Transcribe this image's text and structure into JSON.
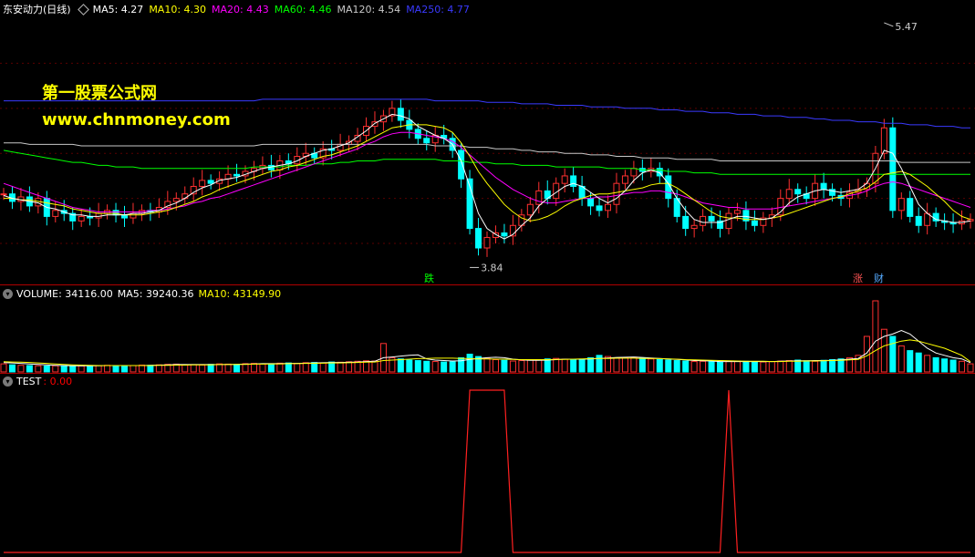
{
  "header": {
    "stock_name": "东安动力(日线)",
    "ma": [
      {
        "label": "MA5: 4.27",
        "color": "#ffffff"
      },
      {
        "label": "MA10: 4.30",
        "color": "#ffff00"
      },
      {
        "label": "MA20: 4.43",
        "color": "#ff00ff"
      },
      {
        "label": "MA60: 4.46",
        "color": "#00ff00"
      },
      {
        "label": "MA120: 4.54",
        "color": "#c8c8c8"
      },
      {
        "label": "MA250: 4.77",
        "color": "#3a3aff"
      }
    ]
  },
  "volume_header": {
    "title": "VOLUME: 34116.00",
    "ma5": "MA5: 39240.36",
    "ma10": "MA10: 43149.90",
    "colors": {
      "title": "#ffffff",
      "ma5": "#ffffff",
      "ma10": "#ffff00"
    }
  },
  "test_header": {
    "title": "TEST",
    "value": ": 0.00",
    "colors": {
      "title": "#ffffff",
      "value": "#ff0000"
    }
  },
  "watermark": {
    "line1": "第一股票公式网",
    "line2": "www.chnmoney.com"
  },
  "annotations": {
    "high": "5.47",
    "low": "3.84",
    "tag_down": "跌",
    "tag_up": "涨",
    "tag_cai": "财"
  },
  "chart_data": [
    {
      "type": "candlestick",
      "title": "东安动力(日线)",
      "ylim": [
        3.8,
        5.5
      ],
      "high_mark": 5.47,
      "low_mark": 3.84,
      "close": [
        4.33,
        4.28,
        4.31,
        4.25,
        4.3,
        4.18,
        4.22,
        4.2,
        4.15,
        4.18,
        4.17,
        4.2,
        4.22,
        4.19,
        4.17,
        4.2,
        4.22,
        4.21,
        4.24,
        4.28,
        4.3,
        4.33,
        4.38,
        4.42,
        4.4,
        4.43,
        4.46,
        4.45,
        4.48,
        4.5,
        4.52,
        4.49,
        4.55,
        4.53,
        4.58,
        4.6,
        4.57,
        4.63,
        4.62,
        4.66,
        4.68,
        4.72,
        4.78,
        4.81,
        4.85,
        4.9,
        4.82,
        4.76,
        4.7,
        4.67,
        4.72,
        4.7,
        4.62,
        4.43,
        4.1,
        3.97,
        4.04,
        4.07,
        4.05,
        4.12,
        4.19,
        4.26,
        4.35,
        4.3,
        4.4,
        4.45,
        4.38,
        4.3,
        4.25,
        4.22,
        4.26,
        4.4,
        4.45,
        4.5,
        4.48,
        4.5,
        4.45,
        4.3,
        4.18,
        4.1,
        4.12,
        4.18,
        4.15,
        4.1,
        4.2,
        4.22,
        4.15,
        4.12,
        4.17,
        4.19,
        4.3,
        4.36,
        4.33,
        4.3,
        4.4,
        4.36,
        4.32,
        4.3,
        4.34,
        4.36,
        4.4,
        4.6,
        4.77,
        4.22,
        4.3,
        4.18,
        4.12,
        4.2,
        4.15,
        4.14,
        4.13,
        4.15,
        4.16
      ],
      "ma5": [
        4.32,
        4.3,
        4.29,
        4.28,
        4.27,
        4.24,
        4.23,
        4.21,
        4.19,
        4.19,
        4.18,
        4.18,
        4.19,
        4.19,
        4.19,
        4.2,
        4.2,
        4.21,
        4.22,
        4.25,
        4.27,
        4.3,
        4.34,
        4.37,
        4.39,
        4.42,
        4.43,
        4.44,
        4.46,
        4.48,
        4.5,
        4.51,
        4.52,
        4.53,
        4.55,
        4.58,
        4.6,
        4.62,
        4.63,
        4.65,
        4.67,
        4.71,
        4.75,
        4.8,
        4.83,
        4.86,
        4.85,
        4.83,
        4.78,
        4.75,
        4.72,
        4.7,
        4.66,
        4.55,
        4.38,
        4.2,
        4.1,
        4.06,
        4.03,
        4.06,
        4.12,
        4.17,
        4.25,
        4.3,
        4.34,
        4.38,
        4.4,
        4.38,
        4.34,
        4.3,
        4.27,
        4.3,
        4.35,
        4.42,
        4.47,
        4.49,
        4.47,
        4.4,
        4.3,
        4.22,
        4.16,
        4.14,
        4.14,
        4.14,
        4.16,
        4.18,
        4.18,
        4.17,
        4.16,
        4.17,
        4.21,
        4.27,
        4.31,
        4.33,
        4.35,
        4.36,
        4.35,
        4.34,
        4.35,
        4.36,
        4.4,
        4.5,
        4.62,
        4.6,
        4.5,
        4.38,
        4.26,
        4.2,
        4.16,
        4.15,
        4.14,
        4.14,
        4.15
      ],
      "ma10": [
        4.3,
        4.3,
        4.29,
        4.29,
        4.28,
        4.27,
        4.26,
        4.25,
        4.23,
        4.22,
        4.21,
        4.2,
        4.2,
        4.2,
        4.19,
        4.19,
        4.19,
        4.2,
        4.21,
        4.22,
        4.24,
        4.26,
        4.28,
        4.31,
        4.33,
        4.36,
        4.38,
        4.4,
        4.42,
        4.44,
        4.46,
        4.48,
        4.49,
        4.51,
        4.52,
        4.54,
        4.56,
        4.58,
        4.59,
        4.61,
        4.63,
        4.65,
        4.68,
        4.71,
        4.74,
        4.77,
        4.78,
        4.79,
        4.79,
        4.79,
        4.78,
        4.77,
        4.74,
        4.67,
        4.58,
        4.48,
        4.4,
        4.33,
        4.26,
        4.21,
        4.17,
        4.15,
        4.16,
        4.18,
        4.21,
        4.25,
        4.28,
        4.3,
        4.32,
        4.33,
        4.33,
        4.34,
        4.35,
        4.36,
        4.37,
        4.39,
        4.4,
        4.4,
        4.37,
        4.33,
        4.29,
        4.25,
        4.21,
        4.18,
        4.17,
        4.17,
        4.16,
        4.16,
        4.16,
        4.17,
        4.18,
        4.2,
        4.22,
        4.24,
        4.26,
        4.28,
        4.3,
        4.31,
        4.33,
        4.35,
        4.37,
        4.41,
        4.46,
        4.47,
        4.48,
        4.46,
        4.42,
        4.38,
        4.33,
        4.28,
        4.22,
        4.18,
        4.16
      ],
      "ma20": [
        4.4,
        4.38,
        4.36,
        4.34,
        4.32,
        4.3,
        4.28,
        4.26,
        4.24,
        4.23,
        4.22,
        4.21,
        4.21,
        4.21,
        4.21,
        4.21,
        4.21,
        4.22,
        4.22,
        4.23,
        4.24,
        4.25,
        4.27,
        4.28,
        4.3,
        4.31,
        4.33,
        4.35,
        4.37,
        4.39,
        4.41,
        4.43,
        4.45,
        4.47,
        4.49,
        4.51,
        4.53,
        4.55,
        4.57,
        4.59,
        4.61,
        4.63,
        4.66,
        4.68,
        4.71,
        4.73,
        4.74,
        4.74,
        4.73,
        4.72,
        4.71,
        4.7,
        4.68,
        4.64,
        4.59,
        4.54,
        4.49,
        4.44,
        4.4,
        4.36,
        4.33,
        4.3,
        4.28,
        4.27,
        4.27,
        4.28,
        4.29,
        4.3,
        4.3,
        4.31,
        4.31,
        4.32,
        4.33,
        4.34,
        4.34,
        4.35,
        4.35,
        4.34,
        4.33,
        4.31,
        4.29,
        4.27,
        4.26,
        4.25,
        4.24,
        4.24,
        4.23,
        4.23,
        4.23,
        4.23,
        4.24,
        4.25,
        4.26,
        4.27,
        4.28,
        4.29,
        4.3,
        4.31,
        4.32,
        4.33,
        4.35,
        4.38,
        4.4,
        4.41,
        4.4,
        4.38,
        4.36,
        4.34,
        4.32,
        4.3,
        4.28,
        4.26,
        4.24
      ],
      "ma60": [
        4.62,
        4.61,
        4.6,
        4.59,
        4.58,
        4.57,
        4.56,
        4.55,
        4.54,
        4.54,
        4.53,
        4.52,
        4.52,
        4.51,
        4.51,
        4.51,
        4.5,
        4.5,
        4.5,
        4.5,
        4.5,
        4.5,
        4.5,
        4.5,
        4.5,
        4.5,
        4.5,
        4.5,
        4.5,
        4.51,
        4.51,
        4.51,
        4.51,
        4.52,
        4.52,
        4.52,
        4.53,
        4.53,
        4.53,
        4.54,
        4.54,
        4.55,
        4.55,
        4.55,
        4.56,
        4.56,
        4.56,
        4.56,
        4.56,
        4.56,
        4.56,
        4.55,
        4.55,
        4.55,
        4.54,
        4.54,
        4.54,
        4.53,
        4.53,
        4.53,
        4.52,
        4.52,
        4.52,
        4.52,
        4.51,
        4.51,
        4.51,
        4.51,
        4.51,
        4.51,
        4.5,
        4.5,
        4.5,
        4.5,
        4.49,
        4.49,
        4.49,
        4.48,
        4.48,
        4.48,
        4.47,
        4.47,
        4.47,
        4.46,
        4.46,
        4.46,
        4.46,
        4.46,
        4.46,
        4.46,
        4.46,
        4.46,
        4.46,
        4.46,
        4.46,
        4.46,
        4.46,
        4.46,
        4.46,
        4.46,
        4.46,
        4.46,
        4.46,
        4.46,
        4.46,
        4.46,
        4.46,
        4.46,
        4.46,
        4.46,
        4.46,
        4.46,
        4.46
      ],
      "ma120": [
        4.67,
        4.67,
        4.67,
        4.66,
        4.66,
        4.66,
        4.66,
        4.66,
        4.66,
        4.65,
        4.65,
        4.65,
        4.65,
        4.65,
        4.65,
        4.65,
        4.65,
        4.65,
        4.65,
        4.65,
        4.65,
        4.65,
        4.65,
        4.65,
        4.65,
        4.65,
        4.65,
        4.65,
        4.65,
        4.65,
        4.66,
        4.66,
        4.66,
        4.66,
        4.66,
        4.66,
        4.66,
        4.66,
        4.66,
        4.66,
        4.66,
        4.66,
        4.66,
        4.66,
        4.66,
        4.66,
        4.66,
        4.66,
        4.66,
        4.66,
        4.65,
        4.65,
        4.65,
        4.65,
        4.64,
        4.64,
        4.64,
        4.63,
        4.63,
        4.63,
        4.62,
        4.62,
        4.61,
        4.61,
        4.61,
        4.6,
        4.6,
        4.6,
        4.59,
        4.59,
        4.59,
        4.58,
        4.58,
        4.58,
        4.57,
        4.57,
        4.57,
        4.57,
        4.56,
        4.56,
        4.56,
        4.56,
        4.56,
        4.55,
        4.55,
        4.55,
        4.55,
        4.55,
        4.55,
        4.55,
        4.55,
        4.55,
        4.55,
        4.55,
        4.55,
        4.55,
        4.55,
        4.55,
        4.55,
        4.55,
        4.55,
        4.55,
        4.55,
        4.55,
        4.54,
        4.54,
        4.54,
        4.54,
        4.54,
        4.54,
        4.54,
        4.54,
        4.54
      ],
      "ma250": [
        4.95,
        4.95,
        4.95,
        4.95,
        4.95,
        4.95,
        4.95,
        4.95,
        4.95,
        4.95,
        4.95,
        4.95,
        4.95,
        4.95,
        4.95,
        4.95,
        4.95,
        4.95,
        4.95,
        4.95,
        4.95,
        4.95,
        4.95,
        4.95,
        4.95,
        4.95,
        4.95,
        4.95,
        4.95,
        4.95,
        4.96,
        4.96,
        4.96,
        4.96,
        4.96,
        4.96,
        4.96,
        4.96,
        4.96,
        4.96,
        4.96,
        4.96,
        4.96,
        4.96,
        4.96,
        4.96,
        4.96,
        4.96,
        4.96,
        4.96,
        4.95,
        4.95,
        4.95,
        4.95,
        4.95,
        4.95,
        4.94,
        4.94,
        4.94,
        4.94,
        4.93,
        4.93,
        4.93,
        4.93,
        4.92,
        4.92,
        4.92,
        4.92,
        4.91,
        4.91,
        4.91,
        4.91,
        4.9,
        4.9,
        4.9,
        4.9,
        4.89,
        4.89,
        4.89,
        4.88,
        4.88,
        4.88,
        4.87,
        4.87,
        4.87,
        4.86,
        4.86,
        4.86,
        4.85,
        4.85,
        4.85,
        4.84,
        4.84,
        4.84,
        4.83,
        4.83,
        4.82,
        4.82,
        4.82,
        4.81,
        4.81,
        4.81,
        4.8,
        4.8,
        4.8,
        4.79,
        4.79,
        4.79,
        4.78,
        4.78,
        4.78,
        4.77,
        4.77
      ]
    },
    {
      "type": "bar",
      "title": "VOLUME",
      "values": [
        34116,
        30000,
        28000,
        27000,
        26000,
        25000,
        26000,
        27000,
        24000,
        25000,
        26000,
        27000,
        28000,
        26000,
        25000,
        27000,
        29000,
        28000,
        30000,
        32000,
        33000,
        30000,
        31000,
        29000,
        32000,
        34000,
        33000,
        31000,
        35000,
        36000,
        34000,
        33000,
        37000,
        38000,
        36000,
        39000,
        40000,
        38000,
        42000,
        41000,
        43000,
        45000,
        47000,
        46000,
        120000,
        60000,
        55000,
        50000,
        48000,
        45000,
        44000,
        42000,
        43000,
        60000,
        75000,
        65000,
        58000,
        52000,
        49000,
        46000,
        48000,
        50000,
        52000,
        55000,
        57000,
        54000,
        52000,
        50000,
        60000,
        70000,
        65000,
        58000,
        60000,
        62000,
        59000,
        55000,
        52000,
        50000,
        48000,
        46000,
        44000,
        45000,
        43000,
        42000,
        44000,
        46000,
        45000,
        43000,
        42000,
        44000,
        46000,
        48000,
        50000,
        47000,
        45000,
        49000,
        52000,
        55000,
        60000,
        70000,
        150000,
        300000,
        180000,
        150000,
        110000,
        90000,
        80000,
        70000,
        60000,
        55000,
        50000,
        45000,
        34116
      ],
      "ma5": [
        39240,
        38000,
        36000,
        34000,
        32000,
        30000,
        28000,
        27000,
        26000,
        26000,
        26000,
        26000,
        27000,
        27000,
        27000,
        27000,
        27000,
        28000,
        29000,
        30000,
        31000,
        31000,
        31000,
        31000,
        31000,
        31000,
        32000,
        32000,
        33000,
        34000,
        35000,
        35000,
        35000,
        36000,
        36000,
        37000,
        38000,
        39000,
        40000,
        40000,
        41000,
        42000,
        44000,
        45000,
        60000,
        63000,
        67000,
        70000,
        72000,
        55000,
        50000,
        48000,
        46000,
        47000,
        53000,
        57000,
        60000,
        62000,
        60000,
        54000,
        51000,
        49000,
        49000,
        50000,
        52000,
        54000,
        54000,
        54000,
        55000,
        57000,
        59000,
        61000,
        62000,
        63000,
        61000,
        59000,
        57000,
        55000,
        53000,
        51000,
        48000,
        47000,
        46000,
        44000,
        44000,
        44000,
        44000,
        44000,
        44000,
        44000,
        45000,
        46000,
        47000,
        47000,
        48000,
        48000,
        49000,
        51000,
        54000,
        57000,
        80000,
        130000,
        150000,
        160000,
        175000,
        160000,
        130000,
        100000,
        80000,
        70000,
        60000,
        55000,
        39240
      ],
      "ma10": [
        43149,
        42000,
        41000,
        40000,
        38000,
        36000,
        34000,
        32000,
        30000,
        29000,
        28000,
        27000,
        27000,
        27000,
        27000,
        27000,
        27000,
        27000,
        28000,
        28000,
        29000,
        29000,
        30000,
        30000,
        30000,
        31000,
        31000,
        32000,
        32000,
        33000,
        33000,
        34000,
        34000,
        35000,
        35000,
        36000,
        36000,
        37000,
        38000,
        38000,
        39000,
        40000,
        41000,
        42000,
        48000,
        50000,
        52000,
        54000,
        56000,
        57000,
        58000,
        58000,
        58000,
        57000,
        56000,
        55000,
        55000,
        54000,
        54000,
        53000,
        52000,
        52000,
        52000,
        52000,
        53000,
        53000,
        54000,
        55000,
        56000,
        57000,
        57000,
        58000,
        58000,
        58000,
        57000,
        57000,
        56000,
        55000,
        54000,
        52000,
        51000,
        50000,
        49000,
        48000,
        47000,
        46000,
        45000,
        45000,
        45000,
        44000,
        44000,
        45000,
        45000,
        46000,
        46000,
        47000,
        48000,
        49000,
        51000,
        53000,
        68000,
        90000,
        110000,
        120000,
        130000,
        135000,
        130000,
        120000,
        110000,
        100000,
        85000,
        70000,
        43149
      ]
    },
    {
      "type": "line",
      "title": "TEST",
      "ylim": [
        0,
        1
      ],
      "values": [
        0,
        0,
        0,
        0,
        0,
        0,
        0,
        0,
        0,
        0,
        0,
        0,
        0,
        0,
        0,
        0,
        0,
        0,
        0,
        0,
        0,
        0,
        0,
        0,
        0,
        0,
        0,
        0,
        0,
        0,
        0,
        0,
        0,
        0,
        0,
        0,
        0,
        0,
        0,
        0,
        0,
        0,
        0,
        0,
        0,
        0,
        0,
        0,
        0,
        0,
        0,
        0,
        0,
        0,
        1,
        1,
        1,
        1,
        1,
        0,
        0,
        0,
        0,
        0,
        0,
        0,
        0,
        0,
        0,
        0,
        0,
        0,
        0,
        0,
        0,
        0,
        0,
        0,
        0,
        0,
        0,
        0,
        0,
        0,
        1,
        0,
        0,
        0,
        0,
        0,
        0,
        0,
        0,
        0,
        0,
        0,
        0,
        0,
        0,
        0,
        0,
        0,
        0,
        0,
        0,
        0,
        0,
        0,
        0,
        0,
        0,
        0,
        0
      ]
    }
  ]
}
